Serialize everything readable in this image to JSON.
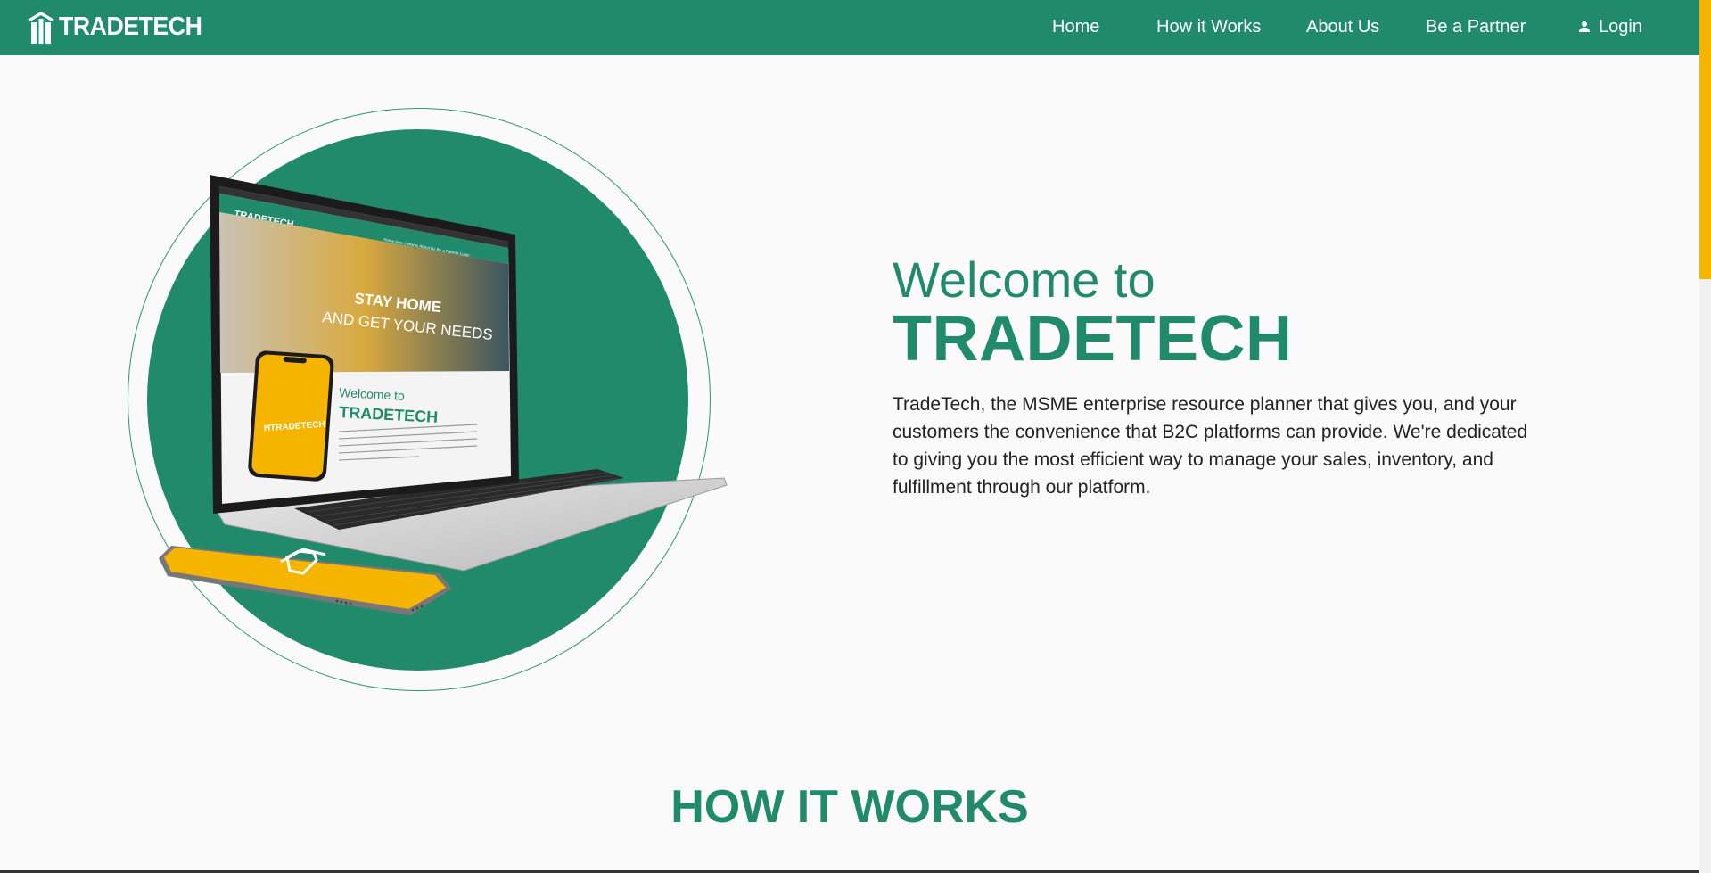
{
  "brand": {
    "logo_text": "TRADETECH"
  },
  "nav": {
    "home": "Home",
    "how_it_works": "How it Works",
    "about_us": "About Us",
    "be_a_partner": "Be a Partner",
    "login": "Login"
  },
  "hero": {
    "welcome": "Welcome to",
    "brand_heading": "TRADETECH",
    "description": "TradeTech, the MSME enterprise resource planner that gives you, and your customers the convenience that B2C platforms can provide. We're dedicated to giving you the most efficient way to manage your sales, inventory, and fulfillment through our platform.",
    "mockup": {
      "screen_logo": "TRADETECH",
      "screen_nav": [
        "Home",
        "How it Works",
        "About Us",
        "Be a Partner",
        "Login"
      ],
      "banner_line1": "STAY HOME",
      "banner_line2": "AND GET YOUR NEEDS",
      "screen_welcome": "Welcome to",
      "screen_brand": "TRADETECH"
    }
  },
  "sections": {
    "how_it_works_title": "HOW IT WORKS"
  },
  "colors": {
    "primary": "#208a6b",
    "accent": "#f5b400",
    "background": "#fafafa",
    "text": "#222222"
  }
}
